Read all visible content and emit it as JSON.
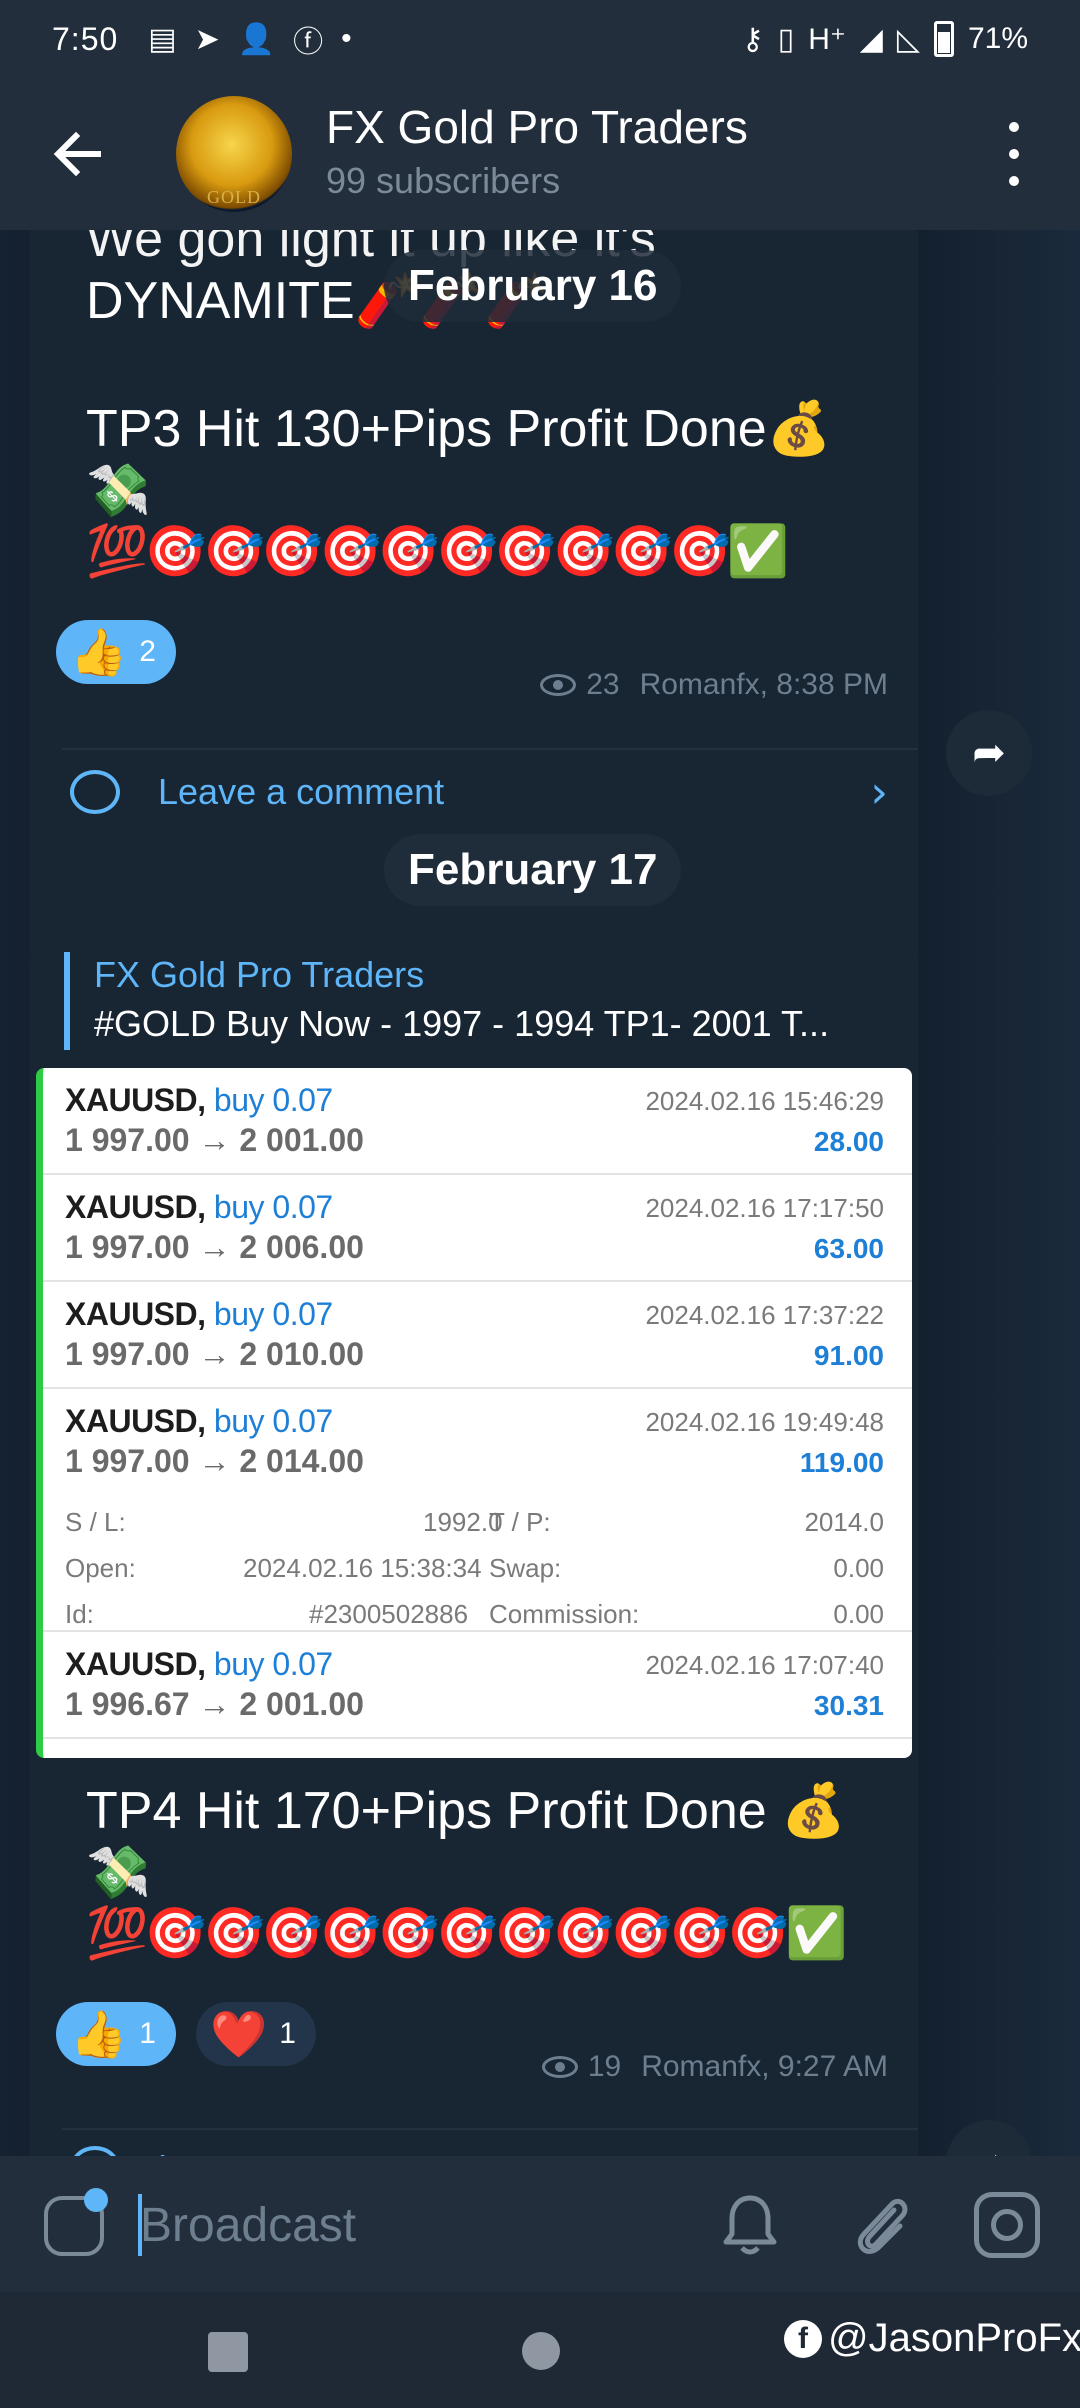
{
  "status": {
    "time": "7:50",
    "network": "H⁺",
    "battery": "71%"
  },
  "header": {
    "title": "FX Gold Pro Traders",
    "subtitle": "99 subscribers",
    "avatar_text": "GOLD"
  },
  "date_pills": [
    "February 16",
    "February 17"
  ],
  "msg1": {
    "partial_line": "We gon light it up like it's",
    "line1": "DYNAMITE🧨🧨🧨",
    "line2": "TP3 Hit 130+Pips Profit Done💰",
    "line3": "💸",
    "emojis": "💯🎯🎯🎯🎯🎯🎯🎯🎯🎯🎯✅",
    "reaction_emoji": "👍",
    "reaction_count": "2",
    "views": "23",
    "author_time": "Romanfx, 8:38 PM",
    "comment_label": "Leave a comment"
  },
  "msg2": {
    "forward_from": "FX Gold Pro Traders",
    "forward_text": "#GOLD Buy Now - 1997 - 1994  TP1-  2001 T...",
    "trades": [
      {
        "symbol": "XAUUSD,",
        "side": "buy 0.07",
        "price": "1 997.00 → 2 001.00",
        "date": "2024.02.16 15:46:29",
        "profit": "28.00"
      },
      {
        "symbol": "XAUUSD,",
        "side": "buy 0.07",
        "price": "1 997.00 → 2 006.00",
        "date": "2024.02.16 17:17:50",
        "profit": "63.00"
      },
      {
        "symbol": "XAUUSD,",
        "side": "buy 0.07",
        "price": "1 997.00 → 2 010.00",
        "date": "2024.02.16 17:37:22",
        "profit": "91.00"
      },
      {
        "symbol": "XAUUSD,",
        "side": "buy 0.07",
        "price": "1 997.00 → 2 014.00",
        "date": "2024.02.16 19:49:48",
        "profit": "119.00"
      },
      {
        "symbol": "XAUUSD,",
        "side": "buy 0.07",
        "price": "1 996.67 → 2 001.00",
        "date": "2024.02.16 17:07:40",
        "profit": "30.31"
      }
    ],
    "details": {
      "sl_label": "S / L:",
      "sl_value": "1992.0",
      "tp_label": "T / P:",
      "tp_value": "2014.0",
      "open_label": "Open:",
      "open_value": "2024.02.16 15:38:34",
      "swap_label": "Swap:",
      "swap_value": "0.00",
      "id_label": "Id:",
      "id_value": "#2300502886",
      "commission_label": "Commission:",
      "commission_value": "0.00"
    },
    "line1": "TP4 Hit 170+Pips Profit Done 💰",
    "line2": "💸",
    "emojis": "💯🎯🎯🎯🎯🎯🎯🎯🎯🎯🎯🎯✅",
    "reaction1_emoji": "👍",
    "reaction1_count": "1",
    "reaction2_emoji": "❤️",
    "reaction2_count": "1",
    "views": "19",
    "author_time": "Romanfx, 9:27 AM",
    "comment_label": "Leave a comment"
  },
  "input": {
    "placeholder": "Broadcast"
  },
  "watermark": "@JasonProFx",
  "watermark_icon": "f",
  "colors": {
    "accent": "#5eb5f7",
    "bubble": "#182533",
    "header": "#232e3c",
    "profit": "#1e7fd6",
    "trade_border": "#2ecb44"
  }
}
